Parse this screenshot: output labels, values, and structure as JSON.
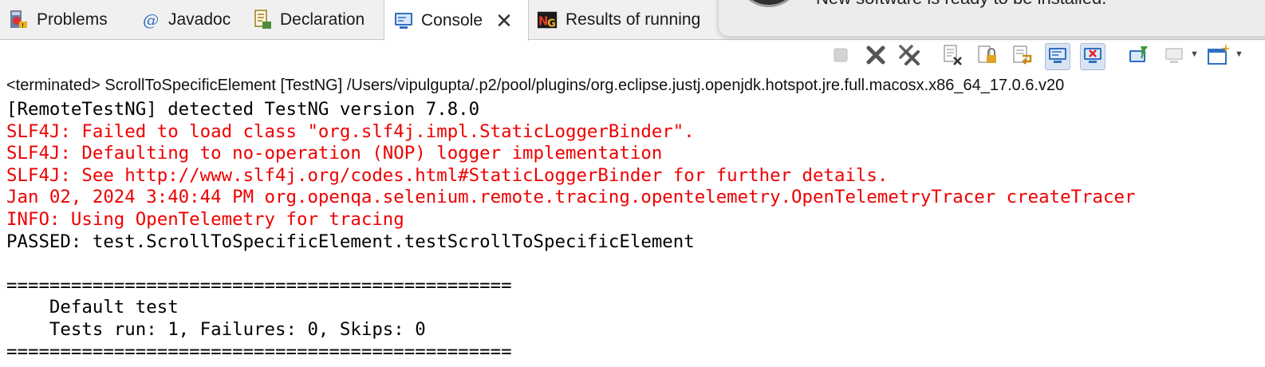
{
  "tabs": [
    {
      "label": "Problems",
      "icon": "problems-icon",
      "active": false
    },
    {
      "label": "Javadoc",
      "icon": "javadoc-at-icon",
      "active": false
    },
    {
      "label": "Declaration",
      "icon": "declaration-icon",
      "active": false
    },
    {
      "label": "Console",
      "icon": "console-icon",
      "active": true
    },
    {
      "label": "Results of running",
      "icon": "testng-icon",
      "active": false
    }
  ],
  "notification": {
    "message": "New software is ready to be installed."
  },
  "process_line": "<terminated> ScrollToSpecificElement [TestNG] /Users/vipulgupta/.p2/pool/plugins/org.eclipse.justj.openjdk.hotspot.jre.full.macosx.x86_64_17.0.6.v20",
  "console": {
    "lines": [
      {
        "text": "[RemoteTestNG] detected TestNG version 7.8.0",
        "stream": "out"
      },
      {
        "text": "SLF4J: Failed to load class \"org.slf4j.impl.StaticLoggerBinder\".",
        "stream": "err"
      },
      {
        "text": "SLF4J: Defaulting to no-operation (NOP) logger implementation",
        "stream": "err"
      },
      {
        "text": "SLF4J: See http://www.slf4j.org/codes.html#StaticLoggerBinder for further details.",
        "stream": "err"
      },
      {
        "text": "Jan 02, 2024 3:40:44 PM org.openqa.selenium.remote.tracing.opentelemetry.OpenTelemetryTracer createTracer",
        "stream": "err"
      },
      {
        "text": "INFO: Using OpenTelemetry for tracing",
        "stream": "err"
      },
      {
        "text": "PASSED: test.ScrollToSpecificElement.testScrollToSpecificElement",
        "stream": "out"
      },
      {
        "text": "",
        "stream": "out"
      },
      {
        "text": "===============================================",
        "stream": "out"
      },
      {
        "text": "    Default test",
        "stream": "out"
      },
      {
        "text": "    Tests run: 1, Failures: 0, Skips: 0",
        "stream": "out"
      },
      {
        "text": "===============================================",
        "stream": "out"
      }
    ]
  },
  "colors": {
    "stderr": "#ee0000",
    "stdout": "#000000",
    "accent_blue": "#2f6fc1"
  }
}
